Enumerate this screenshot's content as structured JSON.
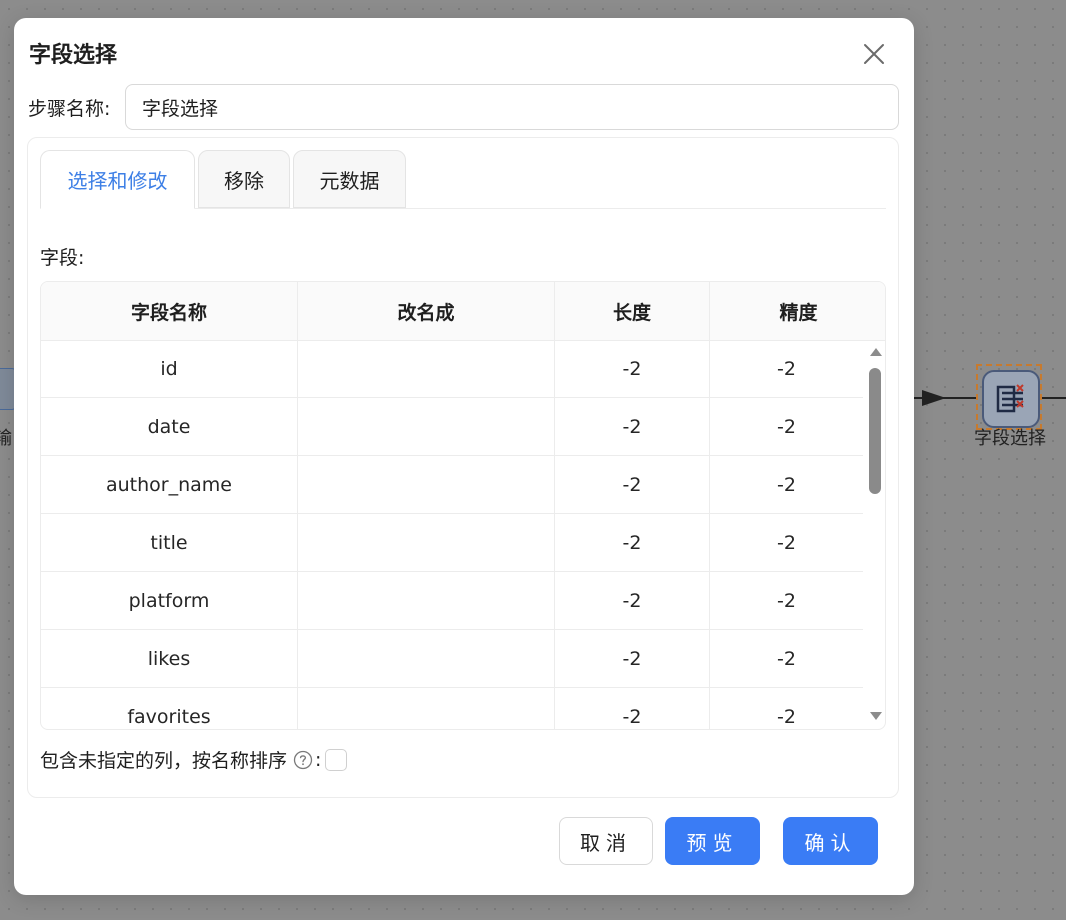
{
  "canvas": {
    "left_node_label": "输",
    "right_node_label": "字段选择"
  },
  "dialog": {
    "title": "字段选择",
    "step_name_label": "步骤名称:",
    "step_name_value": "字段选择",
    "tabs": [
      {
        "label": "选择和修改",
        "active": true
      },
      {
        "label": "移除",
        "active": false
      },
      {
        "label": "元数据",
        "active": false
      }
    ],
    "fields_label": "字段:",
    "table": {
      "headers": [
        "字段名称",
        "改名成",
        "长度",
        "精度"
      ],
      "rows": [
        {
          "name": "id",
          "rename": "",
          "length": "-2",
          "precision": "-2"
        },
        {
          "name": "date",
          "rename": "",
          "length": "-2",
          "precision": "-2"
        },
        {
          "name": "author_name",
          "rename": "",
          "length": "-2",
          "precision": "-2"
        },
        {
          "name": "title",
          "rename": "",
          "length": "-2",
          "precision": "-2"
        },
        {
          "name": "platform",
          "rename": "",
          "length": "-2",
          "precision": "-2"
        },
        {
          "name": "likes",
          "rename": "",
          "length": "-2",
          "precision": "-2"
        },
        {
          "name": "favorites",
          "rename": "",
          "length": "-2",
          "precision": "-2"
        }
      ]
    },
    "include_unspecified_label": "包含未指定的列，按名称排序",
    "include_colon": ":",
    "include_unspecified_checked": false,
    "buttons": {
      "cancel": "取消",
      "preview": "预览",
      "confirm": "确认"
    },
    "colors": {
      "primary": "#3a7cf5",
      "active_tab": "#3d7fe6"
    }
  }
}
